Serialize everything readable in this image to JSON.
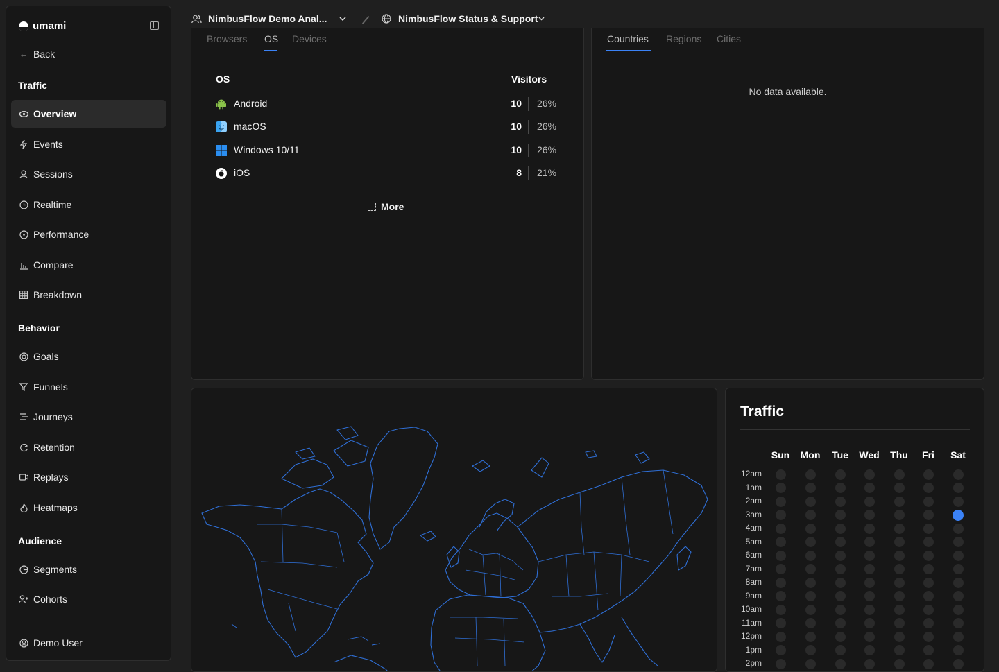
{
  "app": {
    "brand": "umami"
  },
  "sidebar": {
    "back": "Back",
    "sections": {
      "traffic": "Traffic",
      "behavior": "Behavior",
      "audience": "Audience"
    },
    "traffic_items": [
      {
        "label": "Overview",
        "icon": "eye-icon"
      },
      {
        "label": "Events",
        "icon": "lightning-icon"
      },
      {
        "label": "Sessions",
        "icon": "user-icon"
      },
      {
        "label": "Realtime",
        "icon": "clock-icon"
      },
      {
        "label": "Performance",
        "icon": "gauge-icon"
      },
      {
        "label": "Compare",
        "icon": "bar-chart-icon"
      },
      {
        "label": "Breakdown",
        "icon": "grid-icon"
      }
    ],
    "behavior_items": [
      {
        "label": "Goals",
        "icon": "target-icon"
      },
      {
        "label": "Funnels",
        "icon": "funnel-icon"
      },
      {
        "label": "Journeys",
        "icon": "route-icon"
      },
      {
        "label": "Retention",
        "icon": "retention-icon"
      },
      {
        "label": "Replays",
        "icon": "video-icon"
      },
      {
        "label": "Heatmaps",
        "icon": "flame-icon"
      }
    ],
    "audience_items": [
      {
        "label": "Segments",
        "icon": "pie-icon"
      },
      {
        "label": "Cohorts",
        "icon": "users-icon"
      }
    ],
    "user": "Demo User"
  },
  "header": {
    "team": "NimbusFlow Demo Anal...",
    "website": "NimbusFlow Status & Support"
  },
  "os_card": {
    "tabs": [
      "Browsers",
      "OS",
      "Devices"
    ],
    "active_tab": "OS",
    "col_label": "OS",
    "col_value": "Visitors",
    "rows": [
      {
        "name": "Android",
        "count": "10",
        "pct": "26%"
      },
      {
        "name": "macOS",
        "count": "10",
        "pct": "26%"
      },
      {
        "name": "Windows 10/11",
        "count": "10",
        "pct": "26%"
      },
      {
        "name": "iOS",
        "count": "8",
        "pct": "21%"
      }
    ],
    "more": "More"
  },
  "geo_card": {
    "tabs": [
      "Countries",
      "Regions",
      "Cities"
    ],
    "active_tab": "Countries",
    "empty": "No data available."
  },
  "traffic": {
    "title": "Traffic",
    "days": [
      "Sun",
      "Mon",
      "Tue",
      "Wed",
      "Thu",
      "Fri",
      "Sat"
    ],
    "hours": [
      "12am",
      "1am",
      "2am",
      "3am",
      "4am",
      "5am",
      "6am",
      "7am",
      "8am",
      "9am",
      "10am",
      "11am",
      "12pm",
      "1pm",
      "2pm"
    ],
    "active": [
      {
        "day": "Sat",
        "hour": "3am"
      }
    ],
    "accent": "#3b82f6"
  }
}
